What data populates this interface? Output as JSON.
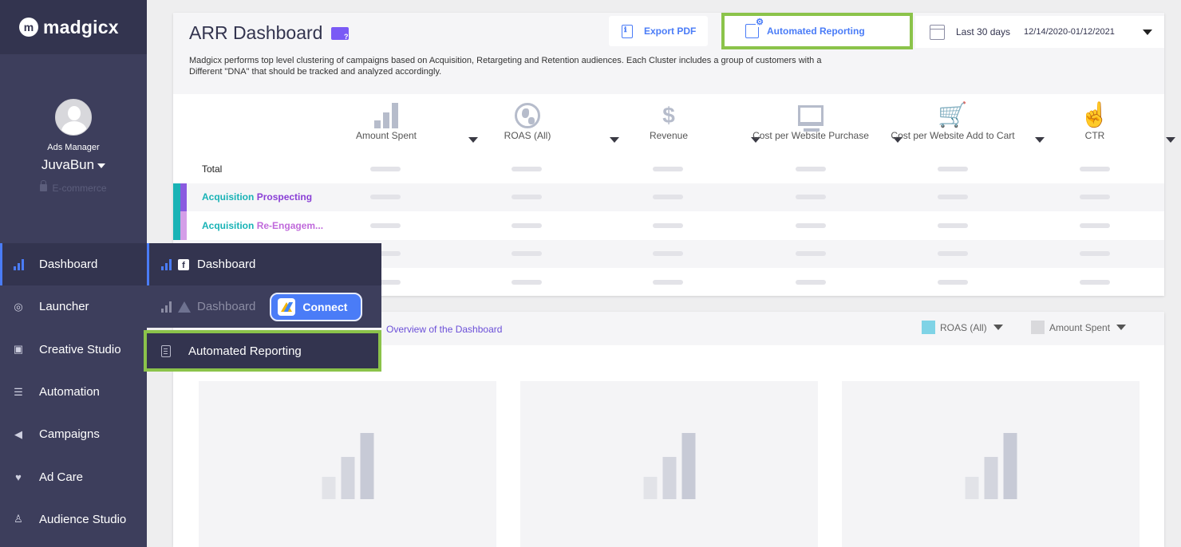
{
  "sidebar": {
    "logo": "madgicx",
    "profile": {
      "role": "Ads Manager",
      "account_name": "JuvaBun",
      "account_type": "E-commerce"
    },
    "nav": [
      {
        "label": "Dashboard",
        "icon": "bar-chart-icon",
        "active": true
      },
      {
        "label": "Launcher",
        "icon": "rocket-icon"
      },
      {
        "label": "Creative Studio",
        "icon": "image-icon"
      },
      {
        "label": "Automation",
        "icon": "sliders-icon"
      },
      {
        "label": "Campaigns",
        "icon": "megaphone-icon"
      },
      {
        "label": "Ad Care",
        "icon": "heart-icon"
      },
      {
        "label": "Audience Studio",
        "icon": "user-icon"
      }
    ]
  },
  "flyout": {
    "facebook_dashboard": "Dashboard",
    "google_dashboard": "Dashboard",
    "connect": "Connect",
    "automated_reporting": "Automated Reporting"
  },
  "header": {
    "title": "ARR Dashboard",
    "description": "Madgicx performs top level clustering of campaigns based on Acquisition, Retargeting and Retention audiences. Each Cluster includes a group of customers with a Different \"DNA\" that should be tracked and analyzed accordingly.",
    "export_pdf": "Export PDF",
    "automated_reporting": "Automated Reporting",
    "date_label": "Last 30 days",
    "date_range": "12/14/2020-01/12/2021"
  },
  "metrics": [
    {
      "label": "Amount Spent",
      "icon": "bar-chart-icon"
    },
    {
      "label": "ROAS (All)",
      "icon": "globe-icon"
    },
    {
      "label": "Revenue",
      "icon": "dollar-icon"
    },
    {
      "label": "Cost per Website Purchase",
      "icon": "monitor-chart-icon"
    },
    {
      "label": "Cost per Website Add to Cart",
      "icon": "cart-check-icon"
    },
    {
      "label": "CTR",
      "icon": "pointer-hand-icon"
    }
  ],
  "rows": [
    {
      "label": "Total"
    },
    {
      "label_a": "Acquisition",
      "label_b": "Prospecting"
    },
    {
      "label_a": "Acquisition",
      "label_b": "Re-Engagem..."
    },
    {},
    {}
  ],
  "lower": {
    "overview_link": "Overview of the Dashboard",
    "legend": [
      {
        "label": "ROAS (All)",
        "color": "#7fd3e6"
      },
      {
        "label": "Amount Spent",
        "color": "#d9d9dc"
      }
    ]
  },
  "colors": {
    "sidebar_bg": "#3d3e5c",
    "accent_blue": "#4a7cf7",
    "highlight_green": "#8bc34a",
    "acquisition_teal": "#19b3b6",
    "cluster_purple": "#8a3fd6"
  }
}
